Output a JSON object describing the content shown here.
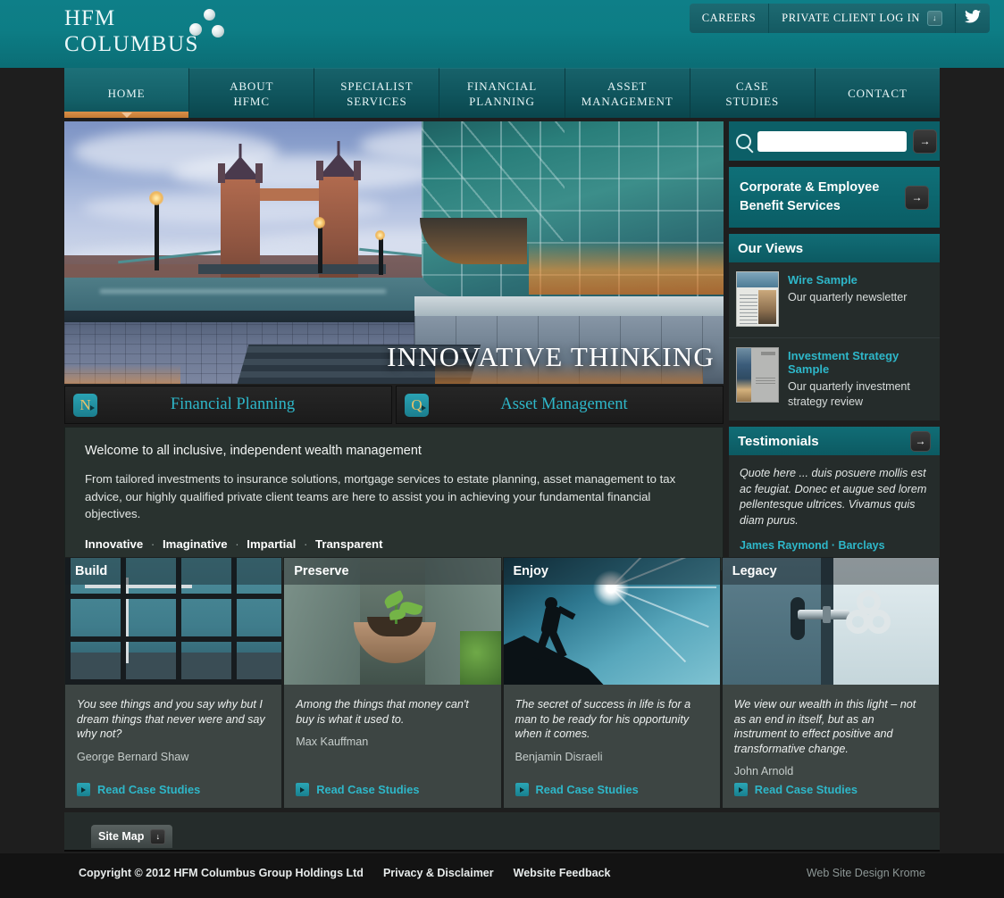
{
  "brand": {
    "line1": "HFM",
    "line2": "COLUMBUS"
  },
  "utility": {
    "careers": "CAREERS",
    "login": "PRIVATE CLIENT LOG IN",
    "login_arrow": "↓",
    "twitter_icon": "🐦"
  },
  "nav": [
    {
      "label": "HOME",
      "active": true
    },
    {
      "label": "ABOUT\nHFMC",
      "active": false
    },
    {
      "label": "SPECIALIST\nSERVICES",
      "active": false
    },
    {
      "label": "FINANCIAL\nPLANNING",
      "active": false
    },
    {
      "label": "ASSET\nMANAGEMENT",
      "active": false
    },
    {
      "label": "CASE\nSTUDIES",
      "active": false
    },
    {
      "label": "CONTACT",
      "active": false
    }
  ],
  "nav_flat": {
    "home": "HOME",
    "about_l1": "ABOUT",
    "about_l2": "HFMC",
    "specialist_l1": "SPECIALIST",
    "specialist_l2": "SERVICES",
    "financial_l1": "FINANCIAL",
    "financial_l2": "PLANNING",
    "asset_l1": "ASSET",
    "asset_l2": "MANAGEMENT",
    "case_l1": "CASE",
    "case_l2": "STUDIES",
    "contact": "CONTACT"
  },
  "hero": {
    "headline": "INNOVATIVE THINKING"
  },
  "tabs": [
    {
      "icon_letter": "N",
      "label": "Financial Planning"
    },
    {
      "icon_letter": "Q",
      "label": "Asset Management"
    }
  ],
  "tabs_flat": {
    "t1_icon": "N",
    "t1_label": "Financial Planning",
    "t2_icon": "Q",
    "t2_label": "Asset Management"
  },
  "welcome": {
    "heading": "Welcome to all inclusive, independent wealth management",
    "body": "From tailored investments to insurance solutions, mortgage services to estate planning, asset management to tax advice, our highly qualified private client teams are here to assist you in achieving your fundamental financial objectives.",
    "pillars": [
      "Innovative",
      "Imaginative",
      "Impartial",
      "Transparent"
    ],
    "p1": "Innovative",
    "p2": "Imaginative",
    "p3": "Impartial",
    "p4": "Transparent",
    "separator": "·"
  },
  "search": {
    "value": "",
    "placeholder": "",
    "submit_arrow": "→"
  },
  "cta": {
    "label": "Corporate & Employee Benefit Services",
    "arrow": "→"
  },
  "our_views": {
    "title": "Our Views",
    "items": [
      {
        "title": "Wire Sample",
        "desc": "Our quarterly newsletter"
      },
      {
        "title": "Investment Strategy Sample",
        "desc": "Our quarterly investment strategy review"
      }
    ],
    "i1_title": "Wire Sample",
    "i1_desc": "Our quarterly newsletter",
    "i2_title": "Investment Strategy Sample",
    "i2_desc": "Our quarterly investment strategy review"
  },
  "testimonials": {
    "title": "Testimonials",
    "arrow": "→",
    "quote": "Quote here ... duis posuere mollis est ac feugiat. Donec et augue sed lorem pellentesque ultrices. Vivamus quis diam purus.",
    "author": "James Raymond · Barclays"
  },
  "cards": {
    "c1_label": "Build",
    "c1_quote": "You see things and you say why but I dream things that never were and say why not?",
    "c1_author": "George Bernard Shaw",
    "c1_link": "Read Case Studies",
    "c2_label": "Preserve",
    "c2_quote": "Among the things that money can't buy is what it used to.",
    "c2_author": "Max Kauffman",
    "c2_link": "Read Case Studies",
    "c3_label": "Enjoy",
    "c3_quote": "The secret of success in life is for a man to be ready for his opportunity when it comes.",
    "c3_author": "Benjamin Disraeli",
    "c3_link": "Read Case Studies",
    "c4_label": "Legacy",
    "c4_quote": "We view our wealth in this light – not as an end in itself, but as an instrument to effect positive and transformative change.",
    "c4_author": "John Arnold",
    "c4_link": "Read Case Studies"
  },
  "footer": {
    "sitemap": "Site Map",
    "sitemap_arrow": "↓",
    "copyright": "Copyright © 2012 HFM Columbus Group Holdings Ltd",
    "privacy": "Privacy & Disclaimer",
    "feedback": "Website Feedback",
    "credit": "Web Site Design Krome"
  },
  "colors": {
    "teal": "#0d7d85",
    "accent_cyan": "#2eb7c9",
    "orange_underline": "#c47a33",
    "page_bg": "#1e1e1e",
    "panel_bg": "#252c2b",
    "welcome_bg": "#29322f"
  }
}
